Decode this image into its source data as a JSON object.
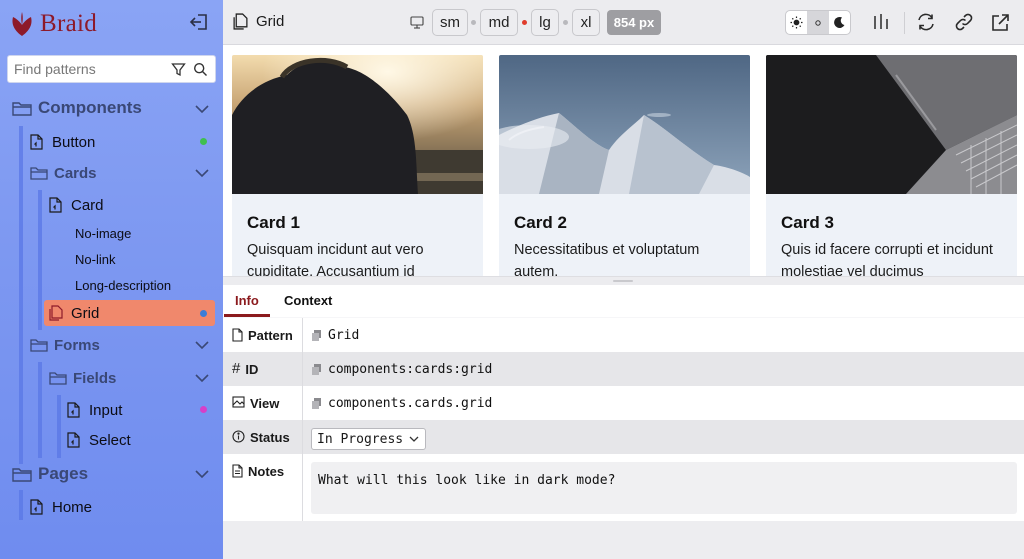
{
  "brand": {
    "name": "Braid",
    "accent": "#8d1a2a"
  },
  "search": {
    "placeholder": "Find patterns"
  },
  "sidebar": {
    "components_label": "Components",
    "button_label": "Button",
    "cards_label": "Cards",
    "card_label": "Card",
    "card_variants": [
      "No-image",
      "No-link",
      "Long-description"
    ],
    "grid_label": "Grid",
    "forms_label": "Forms",
    "fields_label": "Fields",
    "input_label": "Input",
    "select_label": "Select",
    "pages_label": "Pages",
    "home_label": "Home",
    "status_colors": {
      "button": "#3fbf4f",
      "grid": "#3b7dd8",
      "input": "#d63fc9"
    }
  },
  "toolbar": {
    "title": "Grid",
    "breakpoints": [
      "sm",
      "md",
      "lg",
      "xl"
    ],
    "active_breakpoint_dot": "lg",
    "width_badge": "854 px"
  },
  "cards": [
    {
      "title": "Card 1",
      "body": "Quisquam incidunt aut vero cupiditate. Accusantium id"
    },
    {
      "title": "Card 2",
      "body": "Necessitatibus et voluptatum autem."
    },
    {
      "title": "Card 3",
      "body": "Quis id facere corrupti et incidunt molestiae vel ducimus"
    }
  ],
  "tabs": {
    "info": "Info",
    "context": "Context"
  },
  "info": {
    "pattern_label": "Pattern",
    "pattern_value": "Grid",
    "id_label": "ID",
    "id_value": "components:cards:grid",
    "view_label": "View",
    "view_value": "components.cards.grid",
    "status_label": "Status",
    "status_value": "In Progress",
    "notes_label": "Notes",
    "notes_value": "What will this look like in dark mode?"
  }
}
